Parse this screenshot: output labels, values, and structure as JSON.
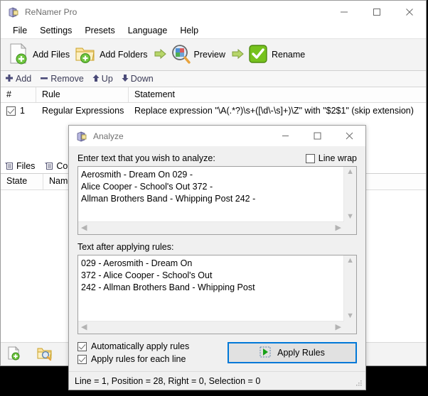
{
  "main_window": {
    "title": "ReNamer Pro",
    "app_icon": "app-icon",
    "window_controls": {
      "minimize": "minimize-icon",
      "maximize": "maximize-icon",
      "close": "close-icon"
    },
    "menubar": [
      {
        "label": "File"
      },
      {
        "label": "Settings"
      },
      {
        "label": "Presets"
      },
      {
        "label": "Language"
      },
      {
        "label": "Help"
      }
    ],
    "toolbar": [
      {
        "label": "Add Files",
        "icon": "add-file-icon"
      },
      {
        "label": "Add Folders",
        "icon": "add-folder-icon"
      },
      {
        "label": "Preview",
        "icon": "preview-magnifier-icon"
      },
      {
        "label": "Rename",
        "icon": "rename-check-icon"
      }
    ],
    "subtoolbar": [
      {
        "label": "Add",
        "icon": "plus-icon"
      },
      {
        "label": "Remove",
        "icon": "minus-icon"
      },
      {
        "label": "Up",
        "icon": "arrow-up-icon"
      },
      {
        "label": "Down",
        "icon": "arrow-down-icon"
      }
    ],
    "rules_grid": {
      "columns": [
        "#",
        "Rule",
        "Statement"
      ],
      "rows": [
        {
          "enabled": true,
          "number": "1",
          "rule": "Regular Expressions",
          "statement": "Replace expression \"\\A(.*?)\\s+([\\d\\-\\s]+)\\Z\" with \"$2$1\" (skip extension)"
        }
      ]
    },
    "tabs": [
      {
        "label": "Files",
        "icon": "files-tab-icon"
      },
      {
        "label": "Colum",
        "icon": "columns-tab-icon"
      }
    ],
    "files_columns": [
      "State",
      "Name"
    ],
    "bottom_toolbar": [
      {
        "icon": "add-file-small-icon"
      },
      {
        "icon": "folder-search-small-icon"
      }
    ]
  },
  "analyze_dialog": {
    "title": "Analyze",
    "icon": "analyze-icon",
    "window_controls": {
      "minimize": "minimize-icon",
      "maximize": "maximize-icon",
      "close": "close-icon"
    },
    "input_label": "Enter text that you wish to analyze:",
    "line_wrap": {
      "label": "Line wrap",
      "checked": false
    },
    "input_text": "Aerosmith - Dream On 029 -\nAlice Cooper - School's Out 372 -\nAllman Brothers Band - Whipping Post 242 -",
    "output_label": "Text after applying rules:",
    "output_text": "029 - Aerosmith - Dream On\n372 - Alice Cooper - School's Out\n242 - Allman Brothers Band - Whipping Post",
    "options": [
      {
        "label": "Automatically apply rules",
        "checked": true
      },
      {
        "label": "Apply rules for each line",
        "checked": true
      }
    ],
    "apply_button": {
      "label": "Apply Rules",
      "icon": "apply-rules-icon"
    },
    "status_text": "Line = 1, Position = 28, Right = 0, Selection = 0",
    "accent_color": "#0078d7"
  }
}
